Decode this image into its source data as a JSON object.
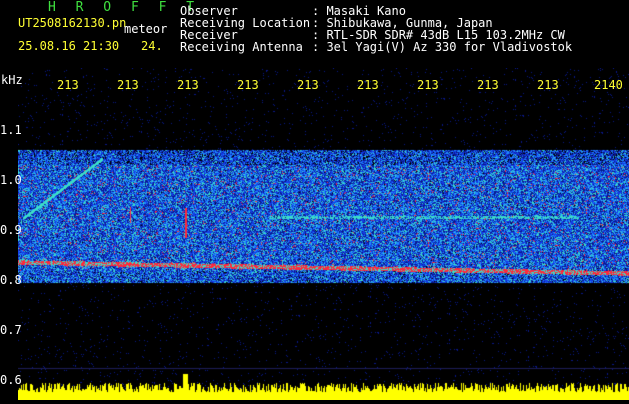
{
  "header": {
    "app_title": "H R O F F T",
    "filename": "UT2508162130.pn",
    "mode": "meteor",
    "date_time": "25.08.16 21:30",
    "step": "24."
  },
  "station": [
    {
      "label": "Observer",
      "value": ": Masaki Kano"
    },
    {
      "label": "Receiving Location",
      "value": ": Shibukawa, Gunma, Japan"
    },
    {
      "label": "Receiver",
      "value": ": RTL-SDR SDR# 43dB L15 103.2MHz CW"
    },
    {
      "label": "Receiving Antenna",
      "value": ": 3el Yagi(V) Az 330 for Vladivostok"
    }
  ],
  "axis": {
    "unit": "kHz",
    "x_ticks": [
      "213",
      "213",
      "213",
      "213",
      "213",
      "213",
      "213",
      "213",
      "213",
      "2140"
    ],
    "y_ticks": [
      "1.1",
      "1.0",
      "0.9",
      "0.8",
      "0.7",
      "0.6"
    ]
  },
  "colors": {
    "header_green": "#3fe03f",
    "tick_yellow": "#ffff33",
    "carrier_red": "#ff2040",
    "noise_blue": "#1a2aff",
    "power_yellow": "#ffff00"
  }
}
